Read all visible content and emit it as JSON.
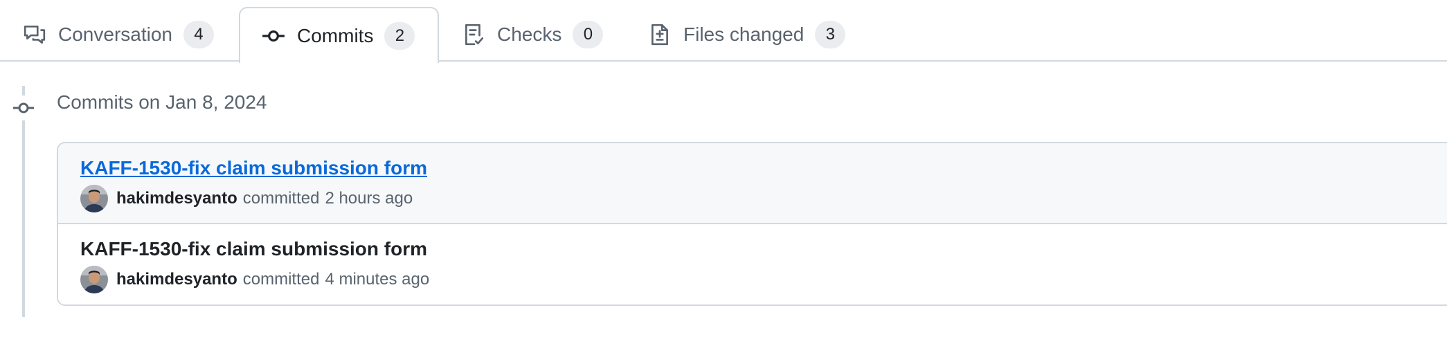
{
  "tabs": [
    {
      "label": "Conversation",
      "count": "4",
      "icon": "comment-discussion-icon"
    },
    {
      "label": "Commits",
      "count": "2",
      "icon": "git-commit-icon",
      "selected": true
    },
    {
      "label": "Checks",
      "count": "0",
      "icon": "checklist-icon"
    },
    {
      "label": "Files changed",
      "count": "3",
      "icon": "file-diff-icon"
    }
  ],
  "colors": {
    "accent": "#0969da",
    "border": "#d1d9e0",
    "muted_text": "#59636e",
    "highlight_row": "#f6f8fa"
  },
  "timeline": {
    "heading": "Commits on Jan 8, 2024",
    "icon": "git-commit-icon",
    "commits": [
      {
        "title": "KAFF-1530-fix claim submission form",
        "author": "hakimdesyanto",
        "verb": "committed",
        "time": "2 hours ago"
      },
      {
        "title": "KAFF-1530-fix claim submission form",
        "author": "hakimdesyanto",
        "verb": "committed",
        "time": "4 minutes ago"
      }
    ]
  }
}
